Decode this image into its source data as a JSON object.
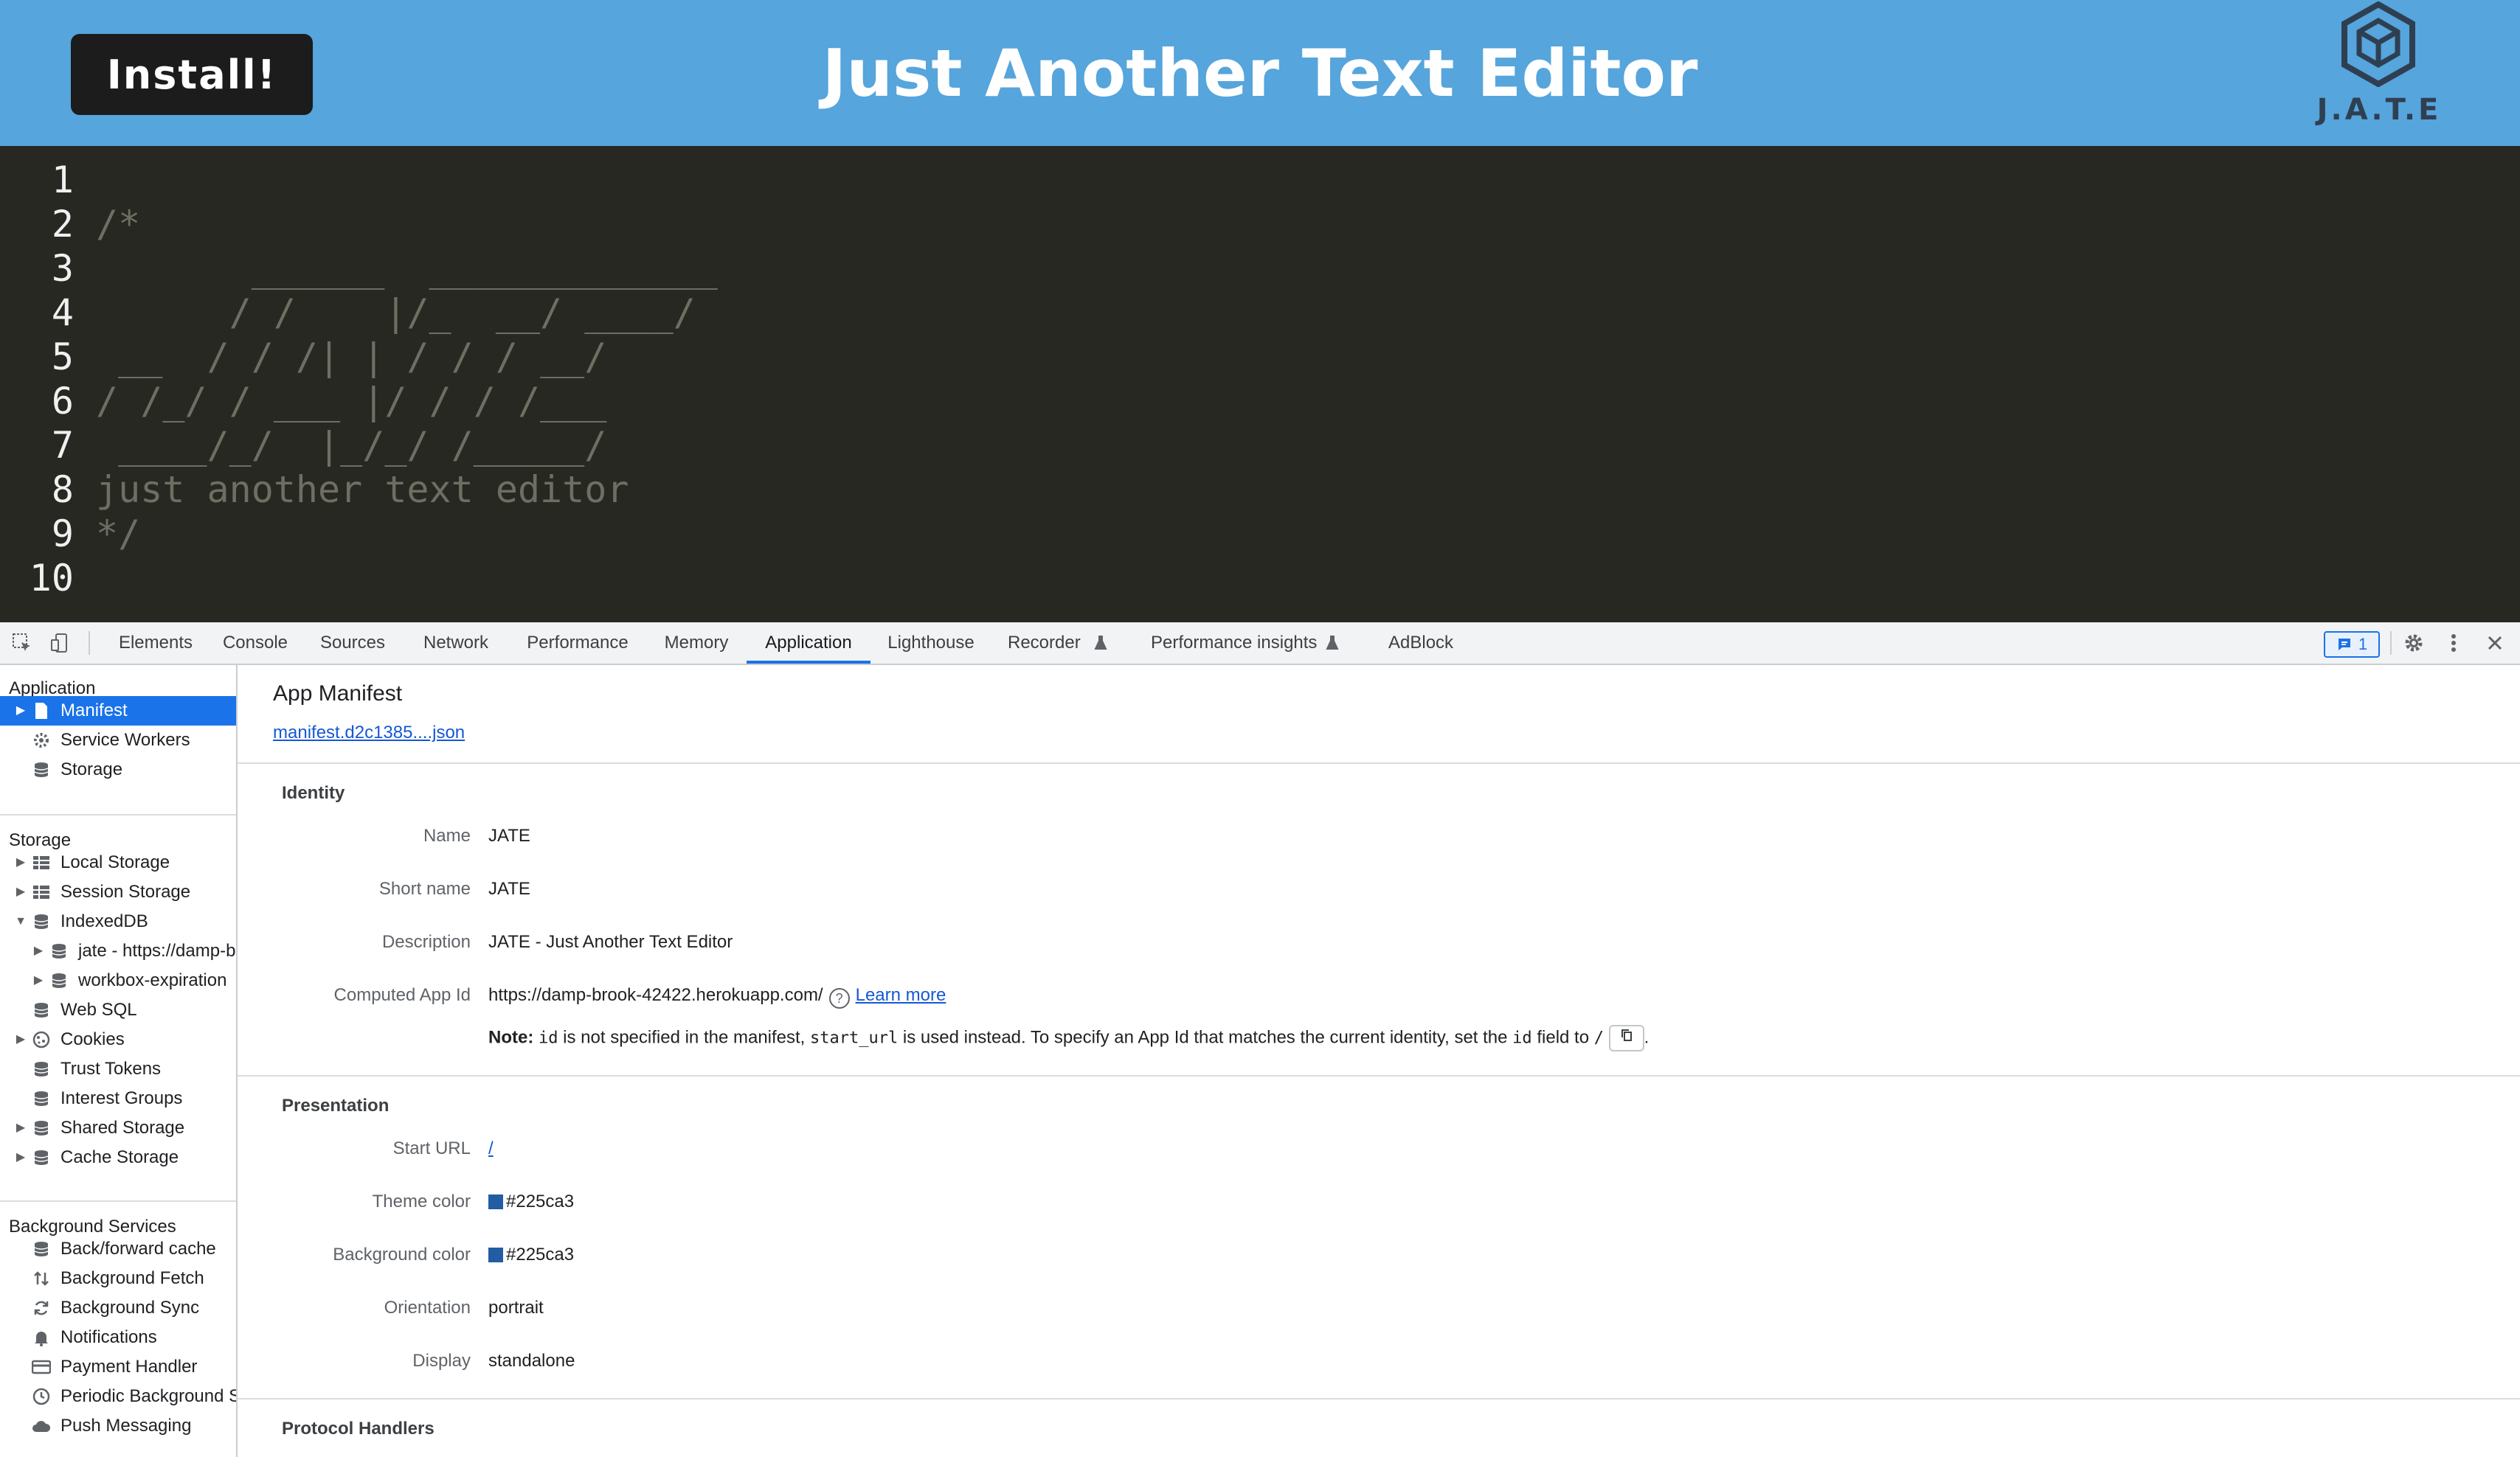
{
  "app": {
    "install_label": "Install!",
    "title": "Just Another Text Editor",
    "logo_text": "J.A.T.E"
  },
  "editor": {
    "lines": [
      {
        "num": "1",
        "text": ""
      },
      {
        "num": "2",
        "text": "/*"
      },
      {
        "num": "3",
        "text": "       ______  _____________"
      },
      {
        "num": "4",
        "text": "      / /    |/_  __/ ____/"
      },
      {
        "num": "5",
        "text": " __  / / /| | / / / __/"
      },
      {
        "num": "6",
        "text": "/ /_/ / ___ |/ / / /___"
      },
      {
        "num": "7",
        "text": " ____/_/  |_/_/ /_____/"
      },
      {
        "num": "8",
        "text": "just another text editor"
      },
      {
        "num": "9",
        "text": "*/"
      },
      {
        "num": "10",
        "text": ""
      }
    ]
  },
  "devtools": {
    "tabs": [
      {
        "label": "Elements"
      },
      {
        "label": "Console"
      },
      {
        "label": "Sources"
      },
      {
        "label": "Network"
      },
      {
        "label": "Performance"
      },
      {
        "label": "Memory"
      },
      {
        "label": "Application"
      },
      {
        "label": "Lighthouse"
      },
      {
        "label": "Recorder"
      },
      {
        "label": "Performance insights"
      },
      {
        "label": "AdBlock"
      }
    ],
    "active_tab": "Application",
    "issues_count": "1"
  },
  "sidebar": {
    "application_header": "Application",
    "application_items": [
      {
        "label": "Manifest"
      },
      {
        "label": "Service Workers"
      },
      {
        "label": "Storage"
      }
    ],
    "storage_header": "Storage",
    "storage_items": [
      {
        "label": "Local Storage"
      },
      {
        "label": "Session Storage"
      },
      {
        "label": "IndexedDB"
      },
      {
        "label": "jate - https://damp-b"
      },
      {
        "label": "workbox-expiration"
      },
      {
        "label": "Web SQL"
      },
      {
        "label": "Cookies"
      },
      {
        "label": "Trust Tokens"
      },
      {
        "label": "Interest Groups"
      },
      {
        "label": "Shared Storage"
      },
      {
        "label": "Cache Storage"
      }
    ],
    "background_header": "Background Services",
    "background_items": [
      {
        "label": "Back/forward cache"
      },
      {
        "label": "Background Fetch"
      },
      {
        "label": "Background Sync"
      },
      {
        "label": "Notifications"
      },
      {
        "label": "Payment Handler"
      },
      {
        "label": "Periodic Background S"
      },
      {
        "label": "Push Messaging"
      }
    ]
  },
  "manifest": {
    "title": "App Manifest",
    "link": "manifest.d2c1385....json",
    "identity": {
      "header": "Identity",
      "name_label": "Name",
      "name": "JATE",
      "short_name_label": "Short name",
      "short_name": "JATE",
      "description_label": "Description",
      "description": "JATE - Just Another Text Editor",
      "app_id_label": "Computed App Id",
      "app_id": "https://damp-brook-42422.herokuapp.com/",
      "learn_more": "Learn more",
      "note_label": "Note:",
      "note_code_id": "id",
      "note_part1": "is not specified in the manifest,",
      "note_code_start": "start_url",
      "note_part2": "is used instead. To specify an App Id that matches the current identity, set the",
      "note_code_id2": "id",
      "note_part3": "field to",
      "note_slash": "/",
      "note_end": "."
    },
    "presentation": {
      "header": "Presentation",
      "start_url_label": "Start URL",
      "start_url": "/",
      "theme_color_label": "Theme color",
      "theme_color": "#225ca3",
      "bg_color_label": "Background color",
      "bg_color": "#225ca3",
      "orientation_label": "Orientation",
      "orientation": "portrait",
      "display_label": "Display",
      "display": "standalone"
    },
    "protocol": {
      "header": "Protocol Handlers"
    }
  }
}
